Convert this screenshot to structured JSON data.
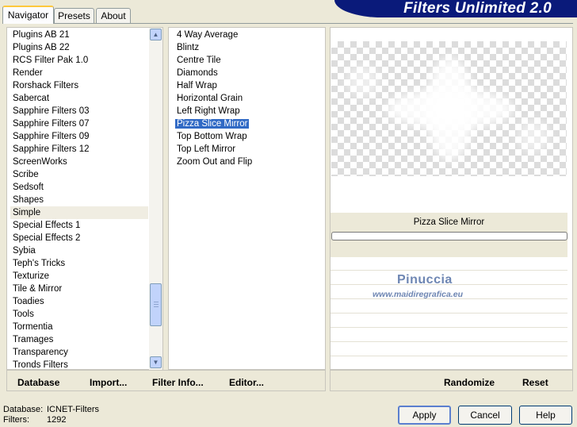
{
  "tabs": [
    {
      "label": "Navigator",
      "active": true
    },
    {
      "label": "Presets",
      "active": false
    },
    {
      "label": "About",
      "active": false
    }
  ],
  "banner": {
    "title": "Filters Unlimited 2.0"
  },
  "categories": [
    "Plugins AB 21",
    "Plugins AB 22",
    "RCS Filter Pak 1.0",
    "Render",
    "Rorshack Filters",
    "Sabercat",
    "Sapphire Filters 03",
    "Sapphire Filters 07",
    "Sapphire Filters 09",
    "Sapphire Filters 12",
    "ScreenWorks",
    "Scribe",
    "Sedsoft",
    "Shapes",
    "Simple",
    "Special Effects 1",
    "Special Effects 2",
    "Sybia",
    "Teph's Tricks",
    "Texturize",
    "Tile & Mirror",
    "Toadies",
    "Tools",
    "Tormentia",
    "Tramages",
    "Transparency",
    "Tronds Filters"
  ],
  "selected_category": "Simple",
  "filters": [
    "4 Way Average",
    "Blintz",
    "Centre Tile",
    "Diamonds",
    "Half Wrap",
    "Horizontal Grain",
    "Left Right Wrap",
    "Pizza Slice Mirror",
    "Top Bottom Wrap",
    "Top Left Mirror",
    "Zoom Out and Flip"
  ],
  "selected_filter": "Pizza Slice Mirror",
  "left_links": {
    "database": "Database",
    "import": "Import...",
    "filter_info": "Filter Info...",
    "editor": "Editor..."
  },
  "right_links": {
    "randomize": "Randomize",
    "reset": "Reset"
  },
  "preview": {
    "filter_name": "Pizza Slice Mirror"
  },
  "watermark": {
    "name": "Pinuccia",
    "url": "www.maidiregrafica.eu"
  },
  "footer": {
    "database_label": "Database:",
    "database_value": "ICNET-Filters",
    "filters_label": "Filters:",
    "filters_value": "1292"
  },
  "buttons": {
    "apply": "Apply",
    "cancel": "Cancel",
    "help": "Help"
  },
  "colors": {
    "banner": "#0a1a7a",
    "selection": "#316ac5",
    "watermark": "#6e86b3"
  },
  "icons": {
    "scroll_up": "chevron-up-icon",
    "scroll_down": "chevron-down-icon"
  }
}
